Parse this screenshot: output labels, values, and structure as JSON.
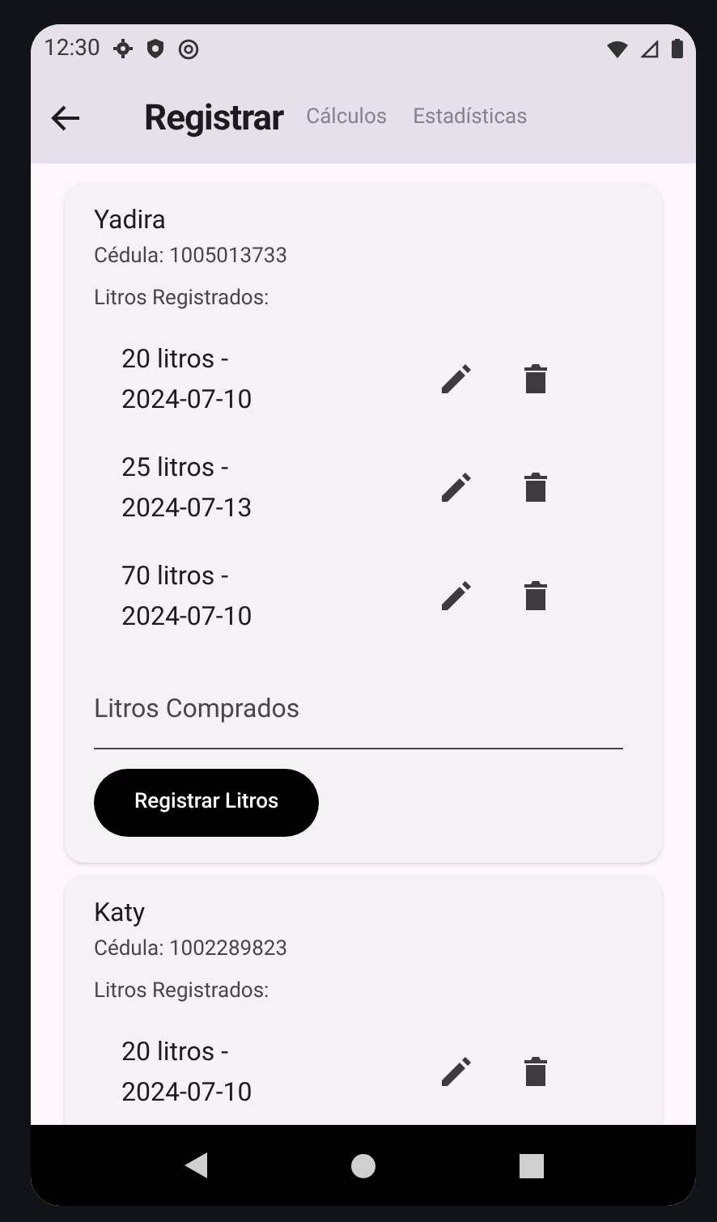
{
  "status_bar": {
    "time": "12:30"
  },
  "app_bar": {
    "tabs": [
      {
        "label": "Registrar",
        "selected": true
      },
      {
        "label": "Cálculos",
        "selected": false
      },
      {
        "label": "Estadísticas",
        "selected": false
      }
    ]
  },
  "customers": [
    {
      "name": "Yadira",
      "id_line": "Cédula: 1005013733",
      "entries_label": "Litros Registrados:",
      "entries": [
        "20 litros - 2024-07-10",
        "25 litros - 2024-07-13",
        "70 litros - 2024-07-10"
      ],
      "input": {
        "placeholder": "Litros Comprados"
      },
      "button": "Registrar Litros"
    },
    {
      "name": "Katy",
      "id_line": "Cédula: 1002289823",
      "entries_label": "Litros Registrados:",
      "entries": [
        "20 litros - 2024-07-10"
      ]
    }
  ]
}
